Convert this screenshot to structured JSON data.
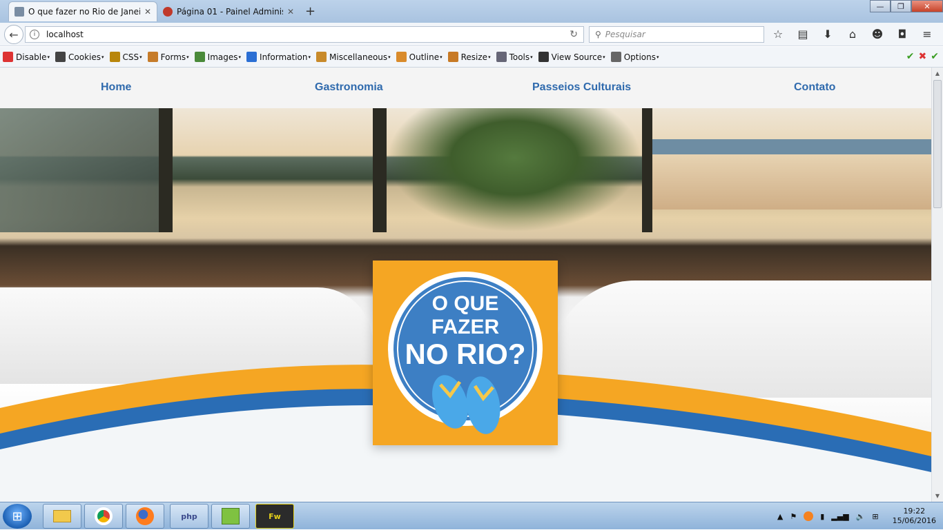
{
  "browser": {
    "tabs": [
      {
        "title": "O que fazer no Rio de Janei...",
        "active": true
      },
      {
        "title": "Página 01 - Painel Adminis...",
        "active": false
      }
    ],
    "new_tab": "+",
    "window_controls": {
      "minimize": "—",
      "maximize": "❐",
      "close": "✕"
    },
    "url": "localhost",
    "search_placeholder": "Pesquisar",
    "toolbar_icons": [
      "star-icon",
      "reading-list-icon",
      "download-icon",
      "home-icon",
      "chat-icon",
      "pocket-icon",
      "menu-icon"
    ]
  },
  "devbar": {
    "items": [
      {
        "label": "Disable",
        "icon": "disable-icon",
        "color": "#d33"
      },
      {
        "label": "Cookies",
        "icon": "cookies-icon",
        "color": "#444"
      },
      {
        "label": "CSS",
        "icon": "css-icon",
        "color": "#b8860b"
      },
      {
        "label": "Forms",
        "icon": "forms-icon",
        "color": "#c67c2a"
      },
      {
        "label": "Images",
        "icon": "images-icon",
        "color": "#4a8a3a"
      },
      {
        "label": "Information",
        "icon": "information-icon",
        "color": "#2b6fd4"
      },
      {
        "label": "Miscellaneous",
        "icon": "miscellaneous-icon",
        "color": "#c88a2a"
      },
      {
        "label": "Outline",
        "icon": "outline-icon",
        "color": "#d98b2b"
      },
      {
        "label": "Resize",
        "icon": "resize-icon",
        "color": "#c77a25"
      },
      {
        "label": "Tools",
        "icon": "tools-icon",
        "color": "#667"
      },
      {
        "label": "View Source",
        "icon": "view-source-icon",
        "color": "#333"
      },
      {
        "label": "Options",
        "icon": "options-icon",
        "color": "#666"
      }
    ]
  },
  "site": {
    "nav": [
      "Home",
      "Gastronomia",
      "Passeios Culturais",
      "Contato"
    ],
    "logo": {
      "line1": "O QUE",
      "line2": "FAZER",
      "line3": "NO RIO?"
    },
    "colors": {
      "link": "#2f6aad",
      "orange": "#f5a623",
      "blue": "#2a6db5"
    }
  },
  "taskbar": {
    "apps": [
      "explorer",
      "chrome",
      "firefox",
      "php",
      "notepad++",
      "Fw"
    ],
    "time": "19:22",
    "date": "15/06/2016"
  }
}
